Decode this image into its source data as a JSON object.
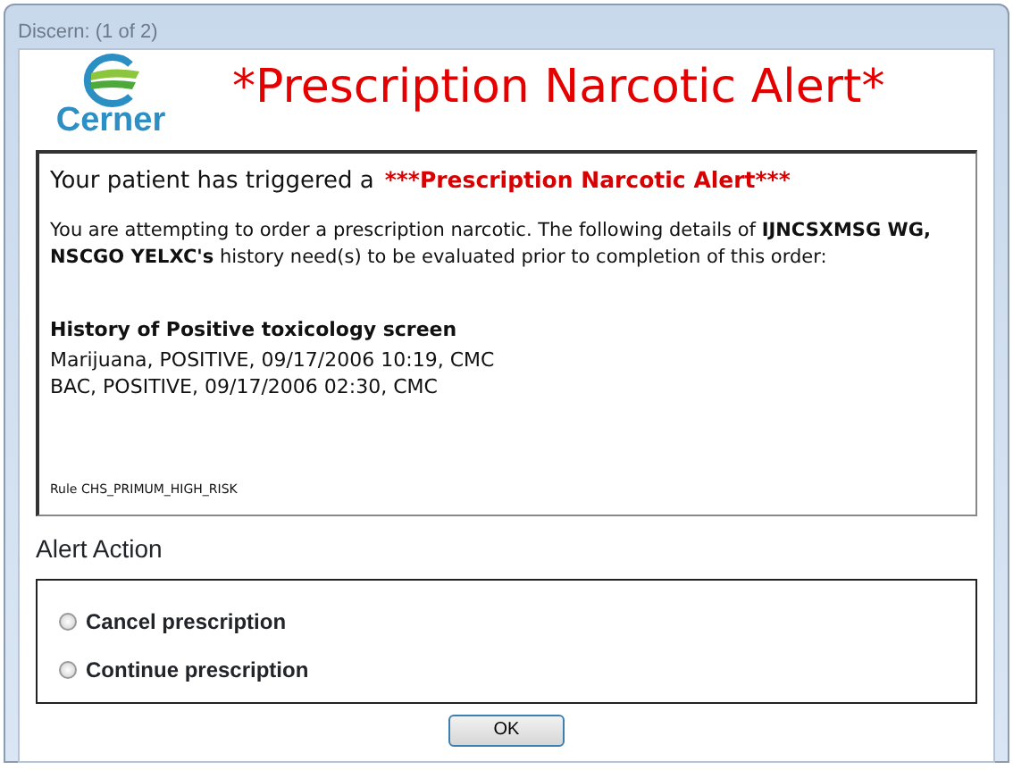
{
  "window": {
    "title": "Discern: (1 of 2)"
  },
  "logo": {
    "text": "Cerner"
  },
  "heading": "*Prescription Narcotic Alert*",
  "message": {
    "intro": "Your patient has triggered a",
    "intro_alert": "***Prescription Narcotic Alert***",
    "details": "You are attempting to order a prescription narcotic. The following details of **IJNCSXMSG WG, NSCGO YELXC's** history need(s) to be evaluated prior to completion of this order:",
    "history_title": "History of Positive toxicology screen",
    "history": [
      "Marijuana, POSITIVE, 09/17/2006 10:19, CMC",
      "BAC, POSITIVE, 09/17/2006 02:30, CMC"
    ],
    "rule": "Rule CHS_PRIMUM_HIGH_RISK"
  },
  "alert_action": {
    "label": "Alert Action",
    "options": [
      {
        "label": "Cancel prescription",
        "selected": false
      },
      {
        "label": "Continue prescription",
        "selected": false
      }
    ]
  },
  "buttons": [
    "OK"
  ]
}
